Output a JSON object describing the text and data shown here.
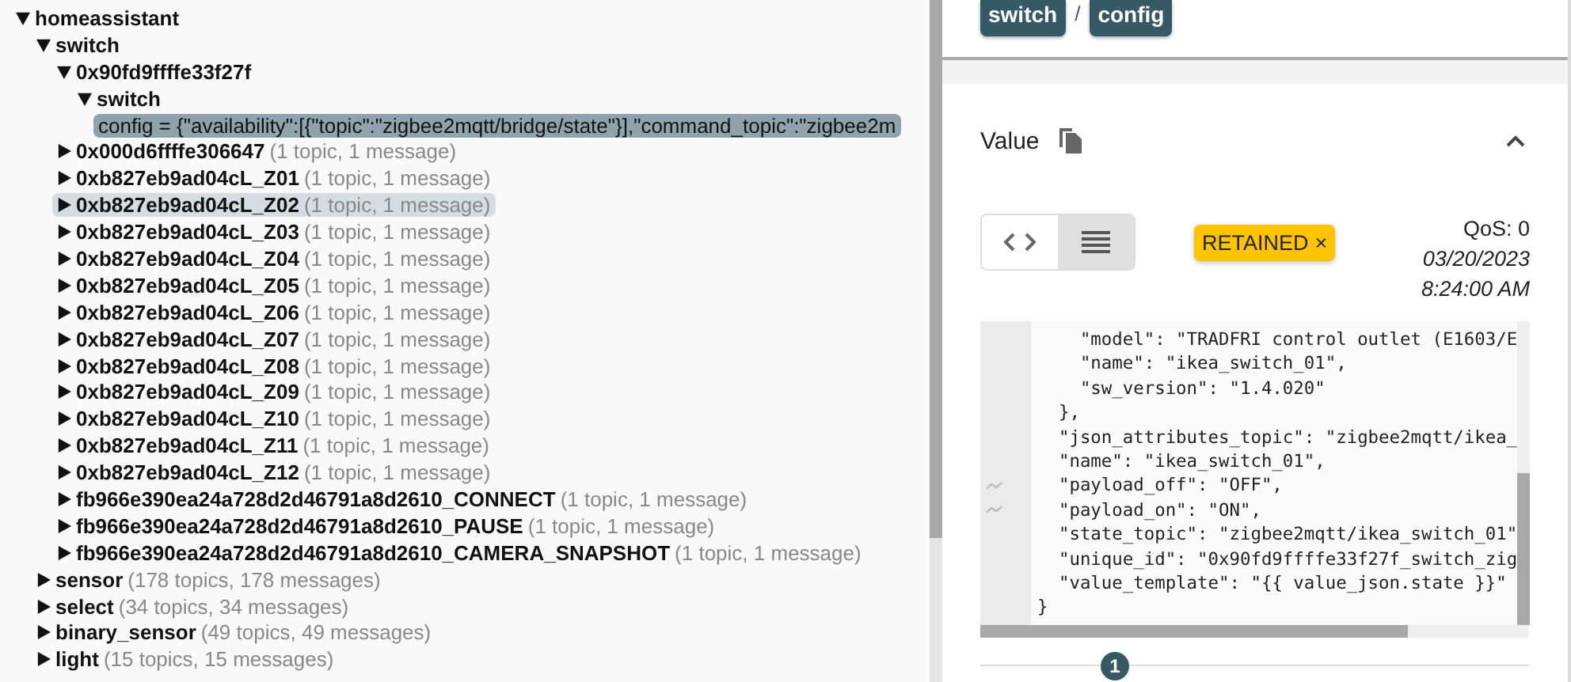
{
  "tree": [
    {
      "label": "homeassistant",
      "expanded": true,
      "selected": false,
      "hovered": false,
      "children": [
        {
          "label": "switch",
          "expanded": true,
          "selected": false,
          "hovered": false,
          "children": [
            {
              "label": "0x90fd9ffffe33f27f",
              "expanded": true,
              "selected": false,
              "hovered": false,
              "children": [
                {
                  "label": "switch",
                  "expanded": true,
                  "selected": false,
                  "hovered": false,
                  "children": [
                    {
                      "label": "config = {\"availability\":[{\"topic\":\"zigbee2mqtt/bridge/state\"}],\"command_topic\":\"zigbee2m",
                      "kind": "value",
                      "selected": true
                    }
                  ]
                }
              ]
            },
            {
              "label": "0x000d6ffffe306647",
              "summary": "(1 topic, 1 message)",
              "expanded": false,
              "selected": false,
              "hovered": false
            },
            {
              "label": "0xb827eb9ad04cL_Z01",
              "summary": "(1 topic, 1 message)",
              "expanded": false,
              "selected": false,
              "hovered": false
            },
            {
              "label": "0xb827eb9ad04cL_Z02",
              "summary": "(1 topic, 1 message)",
              "expanded": false,
              "selected": false,
              "hovered": true
            },
            {
              "label": "0xb827eb9ad04cL_Z03",
              "summary": "(1 topic, 1 message)",
              "expanded": false,
              "selected": false,
              "hovered": false
            },
            {
              "label": "0xb827eb9ad04cL_Z04",
              "summary": "(1 topic, 1 message)",
              "expanded": false,
              "selected": false,
              "hovered": false
            },
            {
              "label": "0xb827eb9ad04cL_Z05",
              "summary": "(1 topic, 1 message)",
              "expanded": false,
              "selected": false,
              "hovered": false
            },
            {
              "label": "0xb827eb9ad04cL_Z06",
              "summary": "(1 topic, 1 message)",
              "expanded": false,
              "selected": false,
              "hovered": false
            },
            {
              "label": "0xb827eb9ad04cL_Z07",
              "summary": "(1 topic, 1 message)",
              "expanded": false,
              "selected": false,
              "hovered": false
            },
            {
              "label": "0xb827eb9ad04cL_Z08",
              "summary": "(1 topic, 1 message)",
              "expanded": false,
              "selected": false,
              "hovered": false
            },
            {
              "label": "0xb827eb9ad04cL_Z09",
              "summary": "(1 topic, 1 message)",
              "expanded": false,
              "selected": false,
              "hovered": false
            },
            {
              "label": "0xb827eb9ad04cL_Z10",
              "summary": "(1 topic, 1 message)",
              "expanded": false,
              "selected": false,
              "hovered": false
            },
            {
              "label": "0xb827eb9ad04cL_Z11",
              "summary": "(1 topic, 1 message)",
              "expanded": false,
              "selected": false,
              "hovered": false
            },
            {
              "label": "0xb827eb9ad04cL_Z12",
              "summary": "(1 topic, 1 message)",
              "expanded": false,
              "selected": false,
              "hovered": false
            },
            {
              "label": "fb966e390ea24a728d2d46791a8d2610_CONNECT",
              "summary": "(1 topic, 1 message)",
              "expanded": false,
              "selected": false,
              "hovered": false
            },
            {
              "label": "fb966e390ea24a728d2d46791a8d2610_PAUSE",
              "summary": "(1 topic, 1 message)",
              "expanded": false,
              "selected": false,
              "hovered": false
            },
            {
              "label": "fb966e390ea24a728d2d46791a8d2610_CAMERA_SNAPSHOT",
              "summary": "(1 topic, 1 message)",
              "expanded": false,
              "selected": false,
              "hovered": false
            }
          ]
        },
        {
          "label": "sensor",
          "summary": "(178 topics, 178 messages)",
          "expanded": false,
          "selected": false,
          "hovered": false
        },
        {
          "label": "select",
          "summary": "(34 topics, 34 messages)",
          "expanded": false,
          "selected": false,
          "hovered": false
        },
        {
          "label": "binary_sensor",
          "summary": "(49 topics, 49 messages)",
          "expanded": false,
          "selected": false,
          "hovered": false
        },
        {
          "label": "light",
          "summary": "(15 topics, 15 messages)",
          "expanded": false,
          "selected": false,
          "hovered": false
        }
      ]
    }
  ],
  "breadcrumb": {
    "parts": [
      "switch",
      "config"
    ],
    "separator": "/"
  },
  "value_panel": {
    "title": "Value",
    "expanded": true,
    "view_toggle": [
      {
        "kind": "code",
        "selected": false
      },
      {
        "kind": "raw",
        "selected": true
      }
    ],
    "retained_badge": {
      "label": "RETAINED",
      "close": "×"
    },
    "qos": "QoS: 0",
    "date": "03/20/2023",
    "time": "8:24:00 AM",
    "code_lines": [
      {
        "text": "    \"model\": \"TRADFRI control outlet (E1603/E",
        "changed": false
      },
      {
        "text": "    \"name\": \"ikea_switch_01\",",
        "changed": false
      },
      {
        "text": "    \"sw_version\": \"1.4.020\"",
        "changed": false
      },
      {
        "text": "  },",
        "changed": false
      },
      {
        "text": "  \"json_attributes_topic\": \"zigbee2mqtt/ikea_",
        "changed": false
      },
      {
        "text": "  \"name\": \"ikea_switch_01\",",
        "changed": false
      },
      {
        "text": "  \"payload_off\": \"OFF\",",
        "changed": true
      },
      {
        "text": "  \"payload_on\": \"ON\",",
        "changed": true
      },
      {
        "text": "  \"state_topic\": \"zigbee2mqtt/ikea_switch_01\"",
        "changed": false
      },
      {
        "text": "  \"unique_id\": \"0x90fd9ffffe33f27f_switch_zig",
        "changed": false
      },
      {
        "text": "  \"value_template\": \"{{ value_json.state }}\"",
        "changed": false
      },
      {
        "text": "}",
        "changed": false
      }
    ],
    "count_badge": "1"
  }
}
